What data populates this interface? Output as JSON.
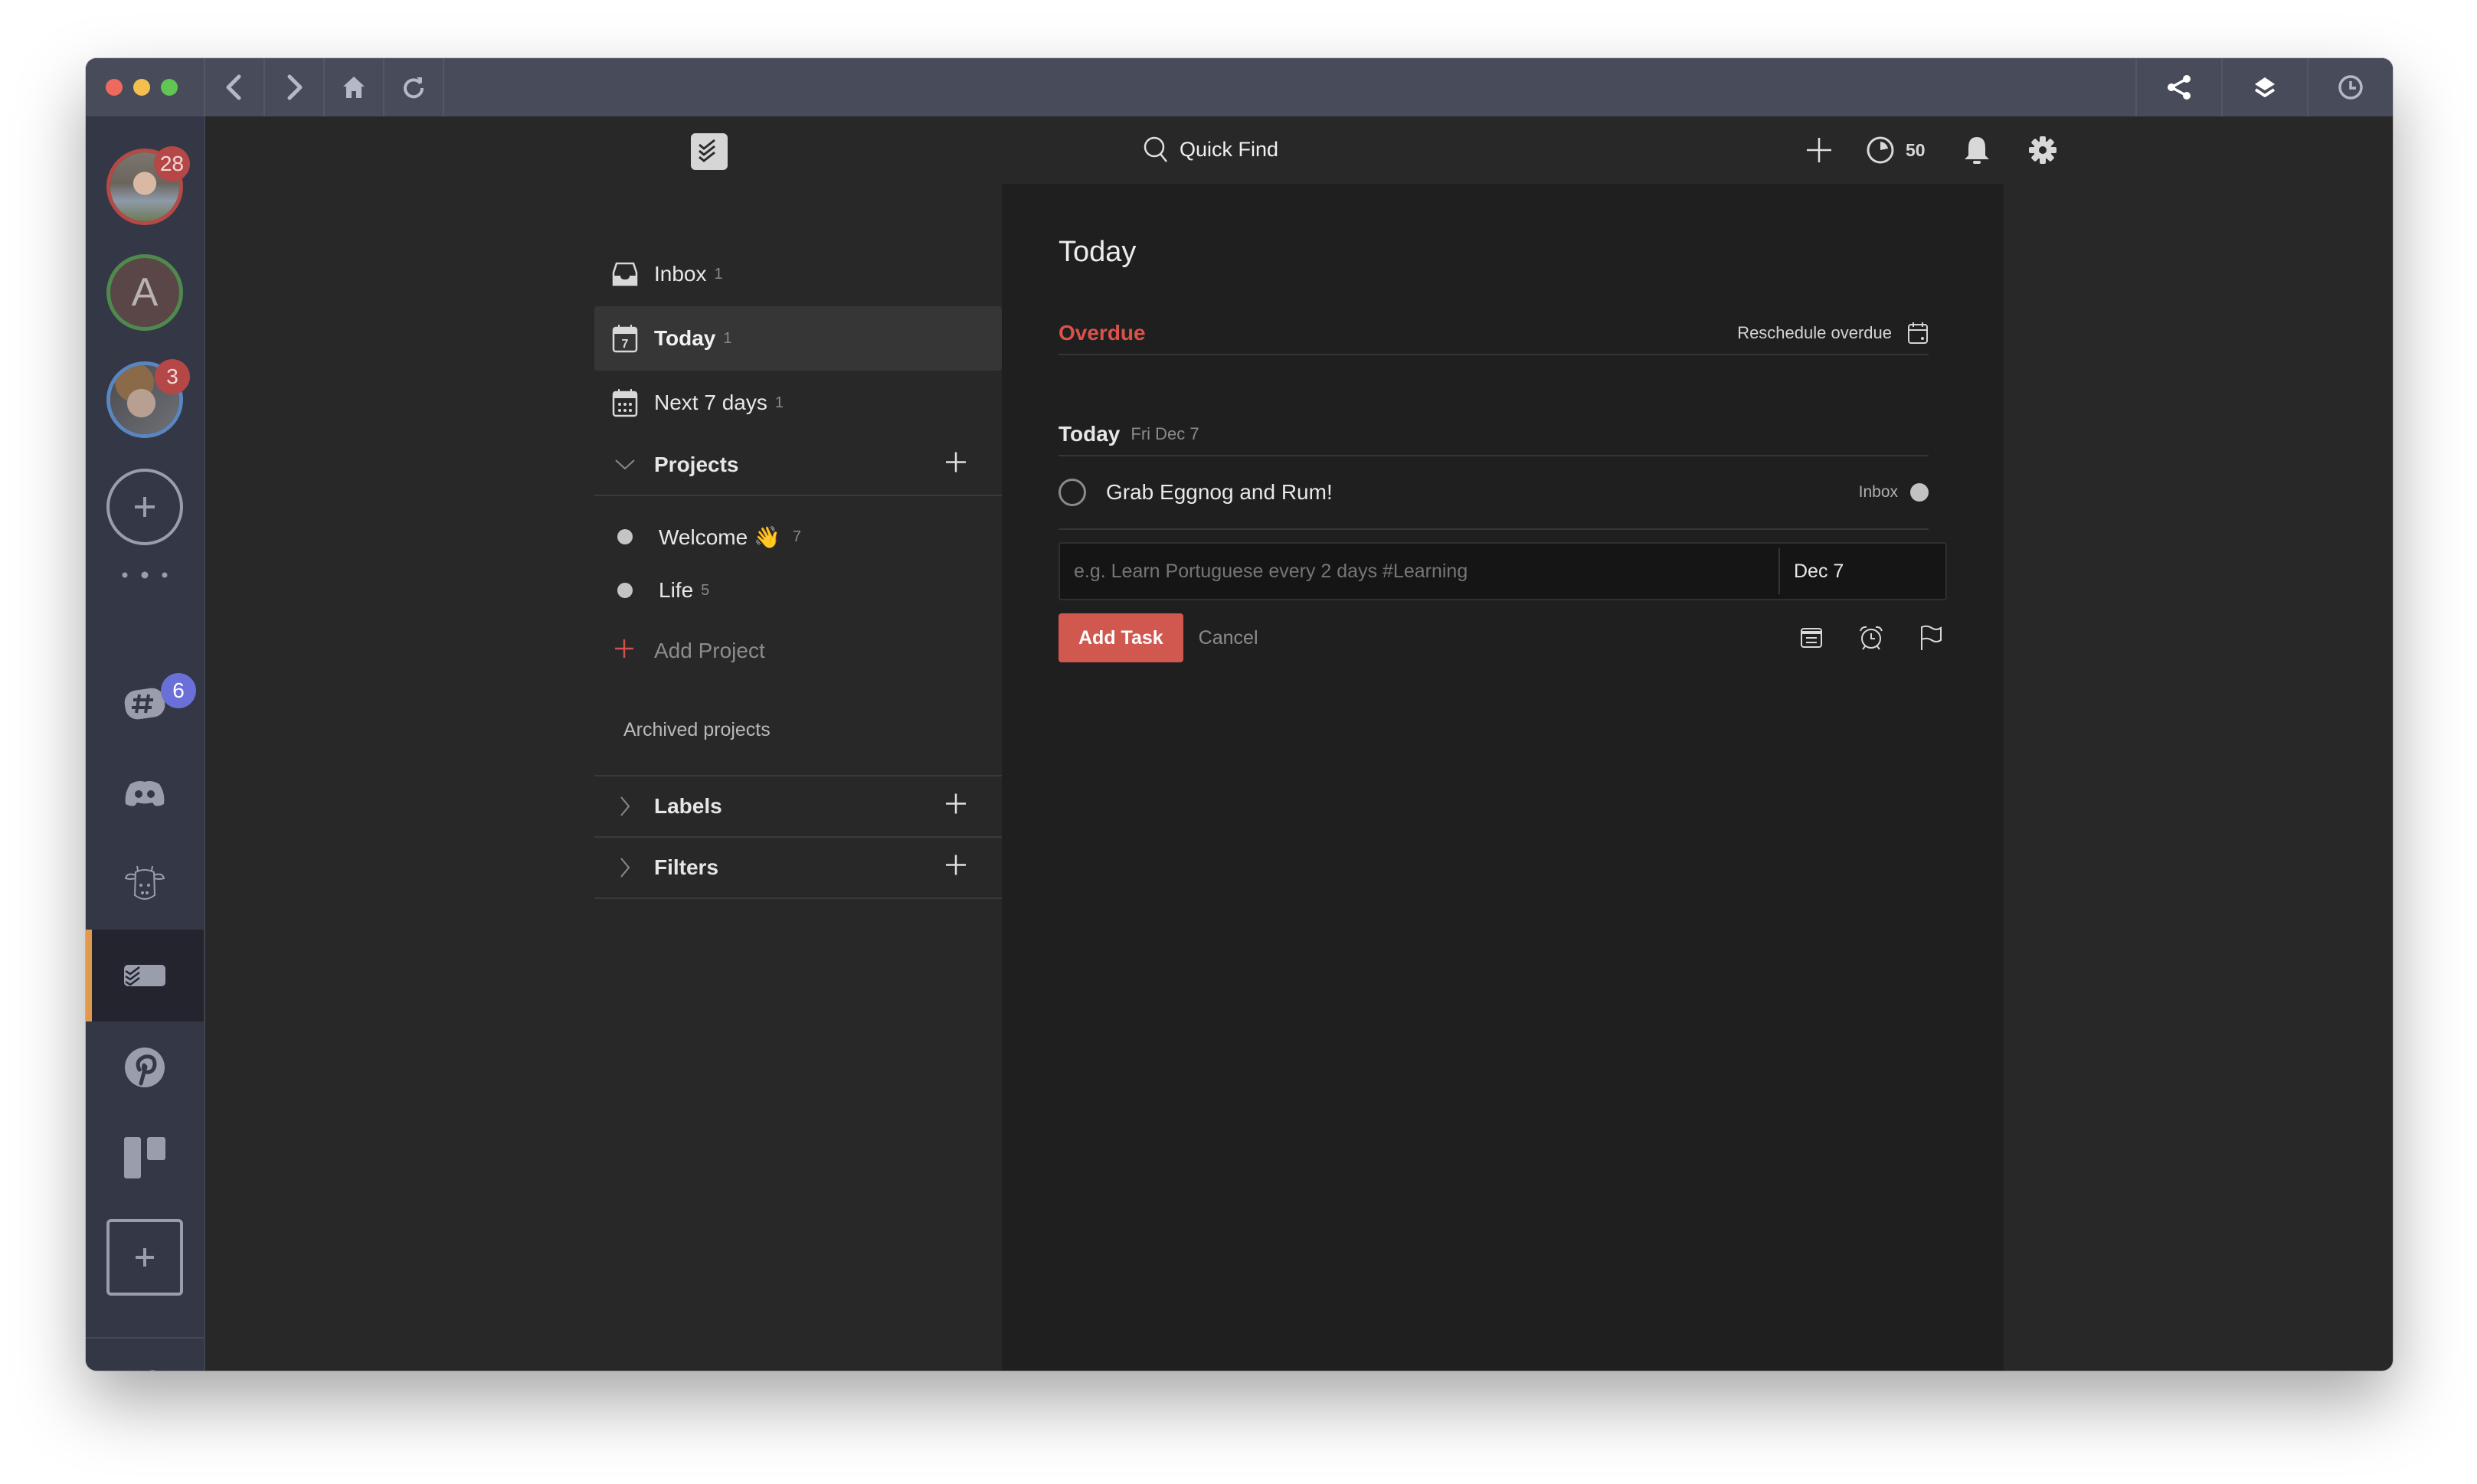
{
  "titlebar": {
    "traffic_lights": {
      "close": "#ee6a5e",
      "minimize": "#f5bf4f",
      "maximize": "#61c554"
    },
    "nav_buttons": [
      "back-icon",
      "forward-icon",
      "home-icon",
      "reload-icon"
    ],
    "right_buttons": [
      "share-icon",
      "layers-icon",
      "clock-icon"
    ]
  },
  "services": {
    "accounts": [
      {
        "name": "account-1",
        "badge": "28",
        "ring_color": "#b54a45"
      },
      {
        "name": "account-2",
        "initial": "A",
        "ring_color": "#4f8a4d"
      },
      {
        "name": "account-3",
        "badge": "3",
        "ring_color": "#5a86c0"
      }
    ],
    "add_account": "plus-icon",
    "apps": [
      {
        "name": "slack",
        "badge": "6",
        "badge_color": "#6b70d8"
      },
      {
        "name": "discord"
      },
      {
        "name": "cow-app"
      },
      {
        "name": "todoist",
        "active": true
      },
      {
        "name": "pinterest"
      },
      {
        "name": "trello"
      }
    ],
    "add_service": "plus-icon",
    "settings": "wrench-icon",
    "active_accent": "#e09a4c"
  },
  "appbar": {
    "search_label": "Quick Find",
    "karma_value": "50"
  },
  "leftnav": {
    "items": [
      {
        "label": "Inbox",
        "count": "1"
      },
      {
        "label": "Today",
        "count": "1",
        "calendar_day": "7"
      },
      {
        "label": "Next 7 days",
        "count": "1"
      }
    ],
    "projects_label": "Projects",
    "projects": [
      {
        "label": "Welcome 👋",
        "count": "7"
      },
      {
        "label": "Life",
        "count": "5"
      }
    ],
    "add_project_label": "Add Project",
    "archived_label": "Archived projects",
    "labels_label": "Labels",
    "filters_label": "Filters"
  },
  "main": {
    "title": "Today",
    "overdue_label": "Overdue",
    "reschedule_label": "Reschedule overdue",
    "today_label": "Today",
    "today_date": "Fri Dec 7",
    "tasks": [
      {
        "text": "Grab Eggnog and Rum!",
        "project": "Inbox"
      }
    ],
    "editor": {
      "placeholder": "e.g. Learn Portuguese every 2 days #Learning",
      "value": "",
      "due_date": "Dec 7"
    },
    "add_task_label": "Add Task",
    "cancel_label": "Cancel",
    "accent_color": "#d0584f"
  }
}
